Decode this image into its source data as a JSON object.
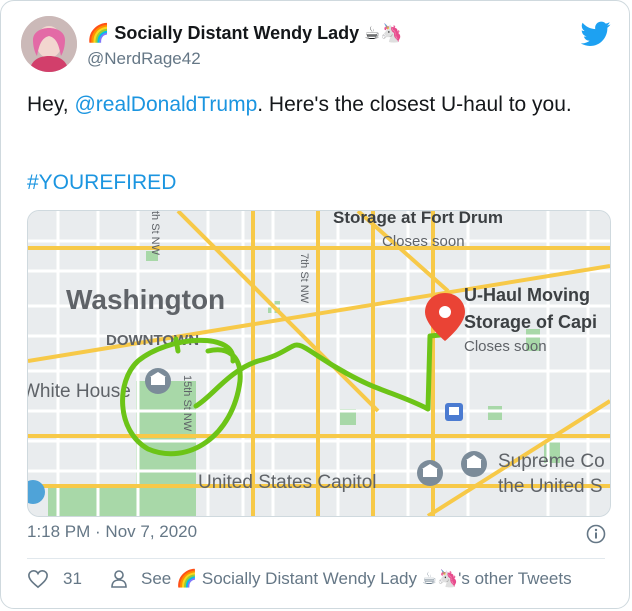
{
  "tweet": {
    "author_name": "🌈 Socially Distant Wendy Lady ☕🦄",
    "author_handle": "@NerdRage42",
    "text_prefix": "Hey, ",
    "mention": "@realDonaldTrump",
    "text_suffix": ". Here's the closest U-haul to you.",
    "hashtag": "#YOUREFIRED",
    "timestamp": "1:18 PM · Nov 7, 2020",
    "like_count": "31",
    "see_more": "See 🌈 Socially Distant Wendy Lady ☕🦄's other Tweets"
  },
  "map": {
    "labels": {
      "storage_fort_drum": "Storage at Fort Drum",
      "closes_soon_top": "Closes soon",
      "washington": "Washington",
      "downtown": "DOWNTOWN",
      "white_house": "White House",
      "uhaul_line1": "U-Haul Moving",
      "uhaul_line2": "Storage of Capi",
      "uhaul_closes": "Closes soon",
      "supreme_line1": "Supreme Co",
      "supreme_line2": "the United S",
      "capitol": "United States Capitol",
      "street_7th": "7th St NW",
      "street_15th": "15th St NW",
      "street_left": "th St NW"
    },
    "colors": {
      "background": "#e9ecee",
      "arterial": "#f7c948",
      "park": "#a8d8a8",
      "route": "#6cc417",
      "pin": "#ea4335"
    }
  },
  "icons": {
    "brand": "twitter-bird-icon",
    "info": "info-icon",
    "like": "heart-icon",
    "profile": "person-icon",
    "pin": "map-pin-icon",
    "landmark": "landmark-icon",
    "metro": "metro-icon"
  }
}
